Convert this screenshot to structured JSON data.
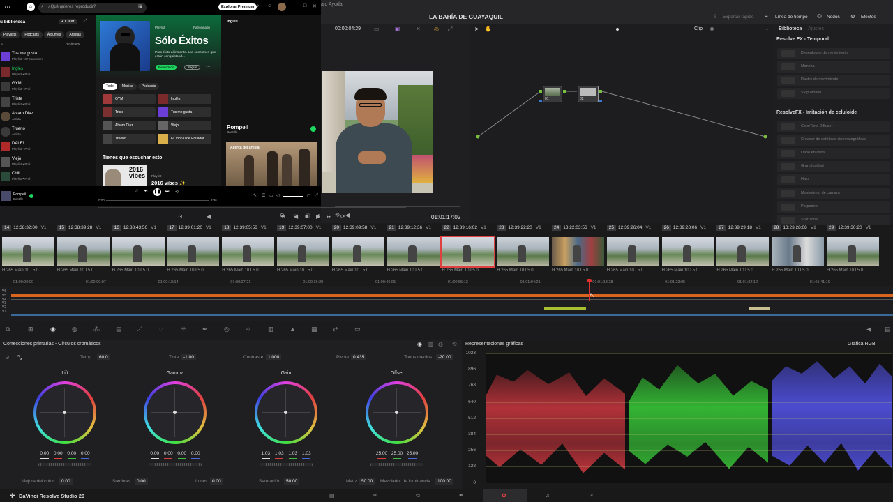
{
  "spotify": {
    "search_placeholder": "¿Qué quieres reproducir?",
    "premium_label": "Explorar Premium",
    "library_title": "u biblioteca",
    "create_label": "+ Crear",
    "filters": [
      "Playlists",
      "Podcasts",
      "Álbumes",
      "Artistas"
    ],
    "recent_label": "Recientes",
    "library_items": [
      {
        "name": "Tus me gusta",
        "sub": "Playlist • 37 canciones",
        "color": "#6b3fd6"
      },
      {
        "name": "Inglés",
        "sub": "Playlist • Prol",
        "color": "#7a2a2a",
        "active": true
      },
      {
        "name": "GYM",
        "sub": "Playlist • Prol",
        "color": "#3a3a3a"
      },
      {
        "name": "Triste",
        "sub": "Playlist • Prol",
        "color": "#444"
      },
      {
        "name": "Alvaro Diaz",
        "sub": "Artista",
        "color": "#5a4a3a"
      },
      {
        "name": "Trueno",
        "sub": "Artista",
        "color": "#3a3a3a"
      },
      {
        "name": "DALE!",
        "sub": "Playlist • Prol",
        "color": "#b02a2a"
      },
      {
        "name": "Viejo",
        "sub": "Playlist • Prol",
        "color": "#555"
      },
      {
        "name": "Chill",
        "sub": "Playlist • Prol",
        "color": "#2a4a3a"
      }
    ],
    "hero": {
      "kind": "Playlist",
      "badge": "Patrocinado",
      "title": "Sólo Éxitos",
      "desc": "Puro éxito al instante. Las canciones que están conquistand...",
      "play_label": "Reproducir",
      "follow_label": "Seguir"
    },
    "tabs": [
      "Todo",
      "Música",
      "Podcasts"
    ],
    "quick": [
      {
        "name": "GYM",
        "color": "#a03a3a"
      },
      {
        "name": "Inglés",
        "color": "#7a2a2a"
      },
      {
        "name": "Triste",
        "color": "#7a3030"
      },
      {
        "name": "Tus me gusta",
        "color": "#6b3fd6"
      },
      {
        "name": "Alvaro Diaz",
        "color": "#555"
      },
      {
        "name": "Viejo",
        "color": "#666"
      },
      {
        "name": "Trueno",
        "color": "#444"
      },
      {
        "name": "El Top 90 de Ecuador",
        "color": "#d9b04a"
      }
    ],
    "section_title": "Tienes que escuchar esto",
    "card": {
      "art_text": "2016 vibes",
      "kind": "Playlist",
      "title": "2016 vibes ✨"
    },
    "right_header": "Inglés",
    "now_playing": {
      "title": "Pompeii",
      "artist": "Bastille",
      "about": "Acerca del artista"
    },
    "player": {
      "time_start": "0:00",
      "time_end": "3:36"
    }
  },
  "resolve": {
    "project_title": "LA BAHÍA DE GUAYAQUIL",
    "menu_help": "ajo  Ayuda",
    "top_buttons": [
      "Exportar rápido",
      "Línea de tiempo",
      "Nodos",
      "Efectos"
    ],
    "viewer_timecode": "00:00:04:29",
    "playhead_timecode": "01:01:17:02",
    "clip_mode": "Clip",
    "library_tabs": [
      "Biblioteca",
      "Ajustes"
    ],
    "fx_groups": [
      {
        "title": "Resolve FX - Temporal",
        "items": [
          "Desenfoque de movimiento",
          "Mancha",
          "Rastro de movimiento",
          "Stop Motion"
        ]
      },
      {
        "title": "ResolveFX - Imitación de celuloide",
        "items": [
          "ColorTone Diffuser",
          "Creador de estéticas cinematográficas",
          "Daño en cinta",
          "Granulosidad",
          "Halo",
          "Movimiento de cámara",
          "Parpadeo",
          "Split Tone"
        ]
      }
    ],
    "nodes": [
      "01",
      "02"
    ],
    "clips": [
      {
        "num": "14",
        "tc": "12:38:32;00",
        "track": "V1"
      },
      {
        "num": "15",
        "tc": "12:38:39;28",
        "track": "V1"
      },
      {
        "num": "16",
        "tc": "12:38:43;56",
        "track": "V1"
      },
      {
        "num": "17",
        "tc": "12:39:01;20",
        "track": "V1"
      },
      {
        "num": "18",
        "tc": "12:39:05;56",
        "track": "V1"
      },
      {
        "num": "19",
        "tc": "12:39:07;00",
        "track": "V1"
      },
      {
        "num": "20",
        "tc": "12:39:09;58",
        "track": "V1"
      },
      {
        "num": "21",
        "tc": "12:39:12;36",
        "track": "V1"
      },
      {
        "num": "22",
        "tc": "12:39:16;02",
        "track": "V1"
      },
      {
        "num": "23",
        "tc": "12:39:22;20",
        "track": "V1"
      },
      {
        "num": "24",
        "tc": "13:22:03;56",
        "track": "V1"
      },
      {
        "num": "25",
        "tc": "12:39:26;04",
        "track": "V1"
      },
      {
        "num": "26",
        "tc": "12:39:28;06",
        "track": "V1"
      },
      {
        "num": "27",
        "tc": "12:39:29;18",
        "track": "V1"
      },
      {
        "num": "28",
        "tc": "13:23:28;08",
        "track": "V1"
      },
      {
        "num": "29",
        "tc": "12:39:30;20",
        "track": "V1"
      }
    ],
    "clip_codec": "H.265 Main 10 L5.0",
    "ruler_marks": [
      "01:00:00:00",
      "01:00:09:07",
      "01:00:18:14",
      "01:00:27:21",
      "01:00:36:28",
      "01:00:46:05",
      "01:00:55:12",
      "01:01:04:21",
      "01:01:13:28",
      "01:01:23:05",
      "01:01:32:12",
      "01:01:41:19"
    ],
    "tracks": [
      "V6",
      "V5",
      "V4",
      "V3",
      "V2",
      "V1"
    ],
    "primaries": {
      "title": "Correcciones primarias - Círculos cromáticos",
      "temp_label": "Temp.",
      "temp": "60.0",
      "tint_label": "Tinte",
      "tint": "-1.00",
      "contrast_label": "Contraste",
      "contrast": "1.000",
      "pivot_label": "Pivote",
      "pivot": "0.435",
      "midtone_label": "Tonos medios",
      "midtone": "-20.00",
      "wheels": [
        {
          "name": "Lift",
          "vals": [
            "0.00",
            "0.00",
            "0.00",
            "0.00"
          ]
        },
        {
          "name": "Gamma",
          "vals": [
            "0.00",
            "0.00",
            "0.00",
            "0.00"
          ]
        },
        {
          "name": "Gain",
          "vals": [
            "1.03",
            "1.03",
            "1.03",
            "1.03"
          ]
        },
        {
          "name": "Offset",
          "vals": [
            "25.00",
            "25.00",
            "25.00"
          ]
        }
      ],
      "bottom": [
        {
          "label": "Mejora del color",
          "val": "0.00"
        },
        {
          "label": "Sombras",
          "val": "0.00"
        },
        {
          "label": "Luces",
          "val": "0.00"
        },
        {
          "label": "Saturación",
          "val": "50.00"
        },
        {
          "label": "Matiz",
          "val": "50.00"
        },
        {
          "label": "Mezclador de luminancia",
          "val": "100.00"
        }
      ]
    },
    "scopes": {
      "title": "Representaciones gráficas",
      "mode": "Gráfica RGB",
      "ticks": [
        "1023",
        "896",
        "768",
        "640",
        "512",
        "384",
        "256",
        "128",
        "0"
      ]
    },
    "app_name": "DaVinci Resolve Studio 20"
  }
}
